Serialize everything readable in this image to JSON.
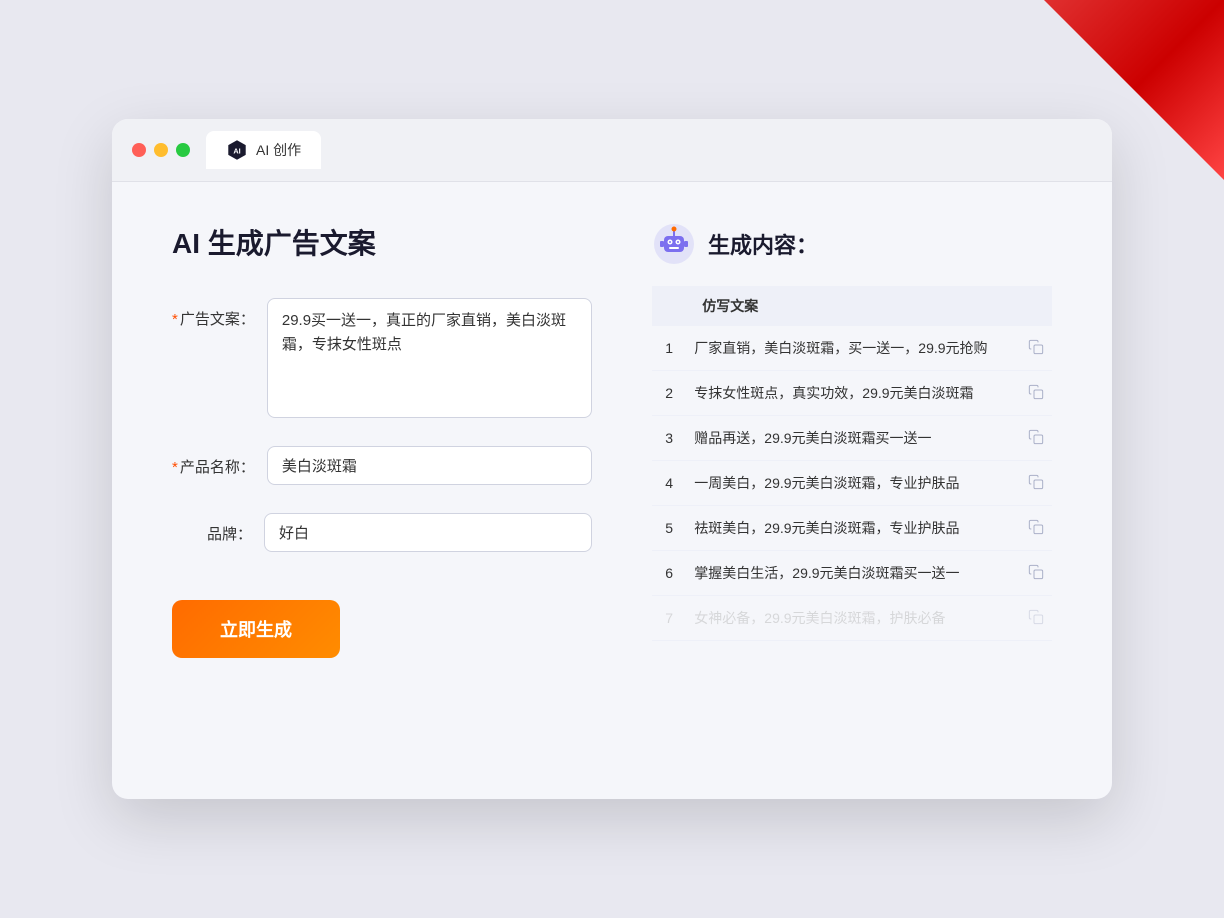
{
  "window": {
    "tab_label": "AI 创作"
  },
  "left_panel": {
    "title": "AI 生成广告文案",
    "ad_copy_label": "广告文案：",
    "ad_copy_required": "*",
    "ad_copy_value": "29.9买一送一，真正的厂家直销，美白淡斑霜，专抹女性斑点",
    "product_name_label": "产品名称：",
    "product_name_required": "*",
    "product_name_value": "美白淡斑霜",
    "brand_label": "品牌：",
    "brand_value": "好白",
    "generate_button": "立即生成"
  },
  "right_panel": {
    "title": "生成内容：",
    "table_header": "仿写文案",
    "results": [
      {
        "num": "1",
        "text": "厂家直销，美白淡斑霜，买一送一，29.9元抢购"
      },
      {
        "num": "2",
        "text": "专抹女性斑点，真实功效，29.9元美白淡斑霜"
      },
      {
        "num": "3",
        "text": "赠品再送，29.9元美白淡斑霜买一送一"
      },
      {
        "num": "4",
        "text": "一周美白，29.9元美白淡斑霜，专业护肤品"
      },
      {
        "num": "5",
        "text": "祛斑美白，29.9元美白淡斑霜，专业护肤品"
      },
      {
        "num": "6",
        "text": "掌握美白生活，29.9元美白淡斑霜买一送一"
      },
      {
        "num": "7",
        "text": "女神必备，29.9元美白淡斑霜，护肤必备",
        "faded": true
      }
    ]
  }
}
